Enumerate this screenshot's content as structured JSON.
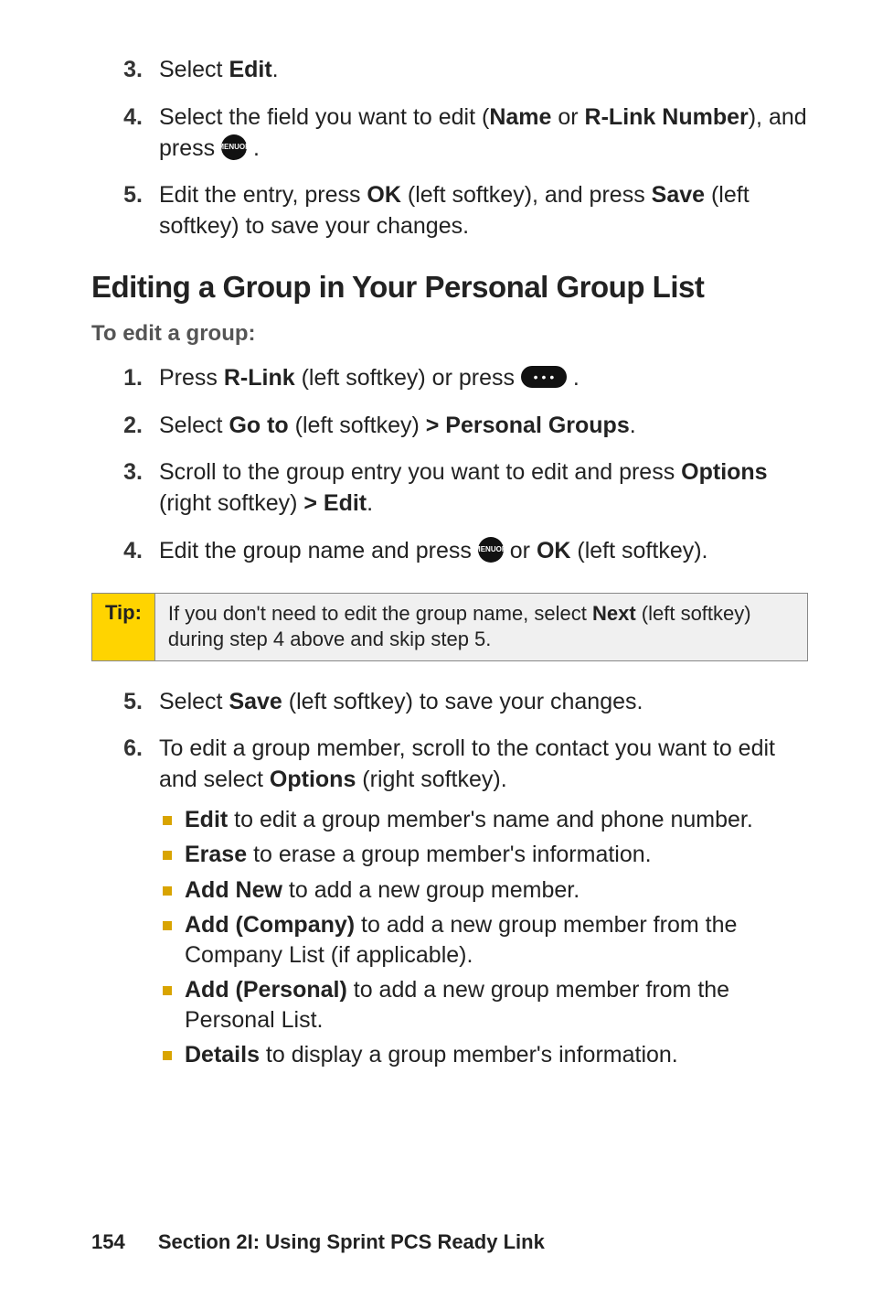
{
  "top_list": [
    {
      "num": "3.",
      "pre": "Select ",
      "bold1": "Edit",
      "post": "."
    },
    {
      "num": "4.",
      "text_parts": [
        "Select the field you want to edit (",
        {
          "b": "Name"
        },
        " or ",
        {
          "b": "R-Link Number"
        },
        "), and press ",
        {
          "icon": "menu"
        },
        " ."
      ]
    },
    {
      "num": "5.",
      "text_parts": [
        "Edit the entry, press ",
        {
          "b": "OK"
        },
        " (left softkey), and press ",
        {
          "b": "Save"
        },
        " (left softkey) to save your changes."
      ]
    }
  ],
  "section_heading": "Editing a Group in Your Personal Group List",
  "subhead": "To edit a group:",
  "mid_list": [
    {
      "num": "1.",
      "text_parts": [
        "Press ",
        {
          "b": "R-Link"
        },
        " (left softkey) or press ",
        {
          "icon": "pill"
        },
        " ."
      ]
    },
    {
      "num": "2.",
      "text_parts": [
        "Select ",
        {
          "b": "Go to"
        },
        " (left softkey) ",
        {
          "b": "> Personal Groups"
        },
        "."
      ]
    },
    {
      "num": "3.",
      "text_parts": [
        "Scroll to the group entry you want to edit and press ",
        {
          "b": "Options"
        },
        " (right softkey) ",
        {
          "b": "> Edit"
        },
        "."
      ]
    },
    {
      "num": "4.",
      "text_parts": [
        "Edit the group name and press ",
        {
          "icon": "menu"
        },
        " or ",
        {
          "b": "OK"
        },
        " (left softkey)."
      ]
    }
  ],
  "tip": {
    "label": "Tip:",
    "body_parts": [
      "If you don't need to edit the group name, select ",
      {
        "b": "Next"
      },
      " (left softkey) during step 4 above and skip step 5."
    ]
  },
  "lower_list": [
    {
      "num": "5.",
      "text_parts": [
        "Select ",
        {
          "b": "Save"
        },
        " (left softkey) to save your changes."
      ]
    },
    {
      "num": "6.",
      "text_parts": [
        "To edit a group member, scroll to the contact you want to edit and select ",
        {
          "b": "Options"
        },
        " (right softkey)."
      ],
      "bullets": [
        [
          {
            "b": "Edit"
          },
          " to edit a group member's name and phone number."
        ],
        [
          {
            "b": "Erase"
          },
          " to erase a group member's information."
        ],
        [
          {
            "b": "Add New"
          },
          " to add a new group member."
        ],
        [
          {
            "b": "Add (Company)"
          },
          " to add a new group member from the Company List (if applicable)."
        ],
        [
          {
            "b": "Add (Personal)"
          },
          " to add a new group member from the Personal List."
        ],
        [
          {
            "b": "Details"
          },
          " to display a group member's information."
        ]
      ]
    }
  ],
  "footer": {
    "page": "154",
    "section": "Section 2I: Using Sprint PCS Ready Link"
  },
  "icons": {
    "menu_label_top": "MENU",
    "menu_label_bottom": "OK",
    "pill_dots": "•••"
  }
}
